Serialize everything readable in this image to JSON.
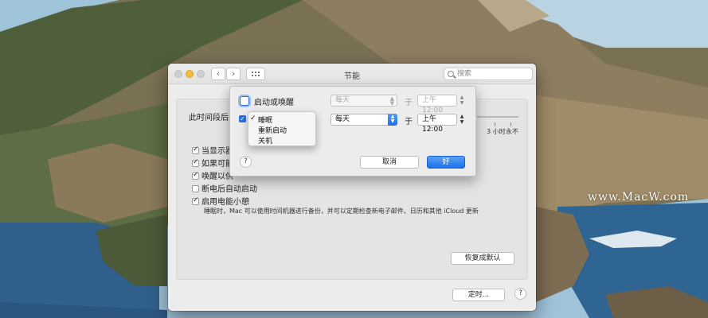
{
  "window": {
    "title": "节能",
    "search_placeholder": "搜索",
    "nav_back": "‹",
    "nav_forward": "›"
  },
  "panel": {
    "period_label": "此时间段后关",
    "slider_ticks": [
      "3 小时",
      "永不"
    ],
    "checkboxes": [
      {
        "label": "当显示器",
        "checked": true
      },
      {
        "label": "如果可能",
        "checked": true
      },
      {
        "label": "唤醒以供",
        "checked": true
      },
      {
        "label": "断电后自动启动",
        "checked": false
      },
      {
        "label": "启用电能小憩",
        "checked": true
      }
    ],
    "power_nap_note": "睡眠时，Mac 可以使用时间机器进行备份，并可以定期检查新电子邮件、日历和其他 iCloud 更新",
    "restore_defaults": "恢复成默认",
    "schedule_button": "定时...",
    "help": "?"
  },
  "schedule_sheet": {
    "start_wake_label": "启动或唤醒",
    "start_wake_checked": false,
    "row1_frequency": "每天",
    "row1_at": "于",
    "row1_time": "上午12:00",
    "row2_checked": true,
    "row2_frequency": "每天",
    "row2_at": "于",
    "row2_time": "上午12:00",
    "help": "?",
    "cancel": "取消",
    "ok": "好",
    "action_menu": {
      "items": [
        "睡眠",
        "重新启动",
        "关机"
      ],
      "selected": "睡眠",
      "check_mark": "✓"
    }
  },
  "watermark": "www.MacW.com",
  "colors": {
    "accent": "#1f6fe5",
    "window_bg": "#ececec",
    "sea": "#2f5f8a"
  }
}
